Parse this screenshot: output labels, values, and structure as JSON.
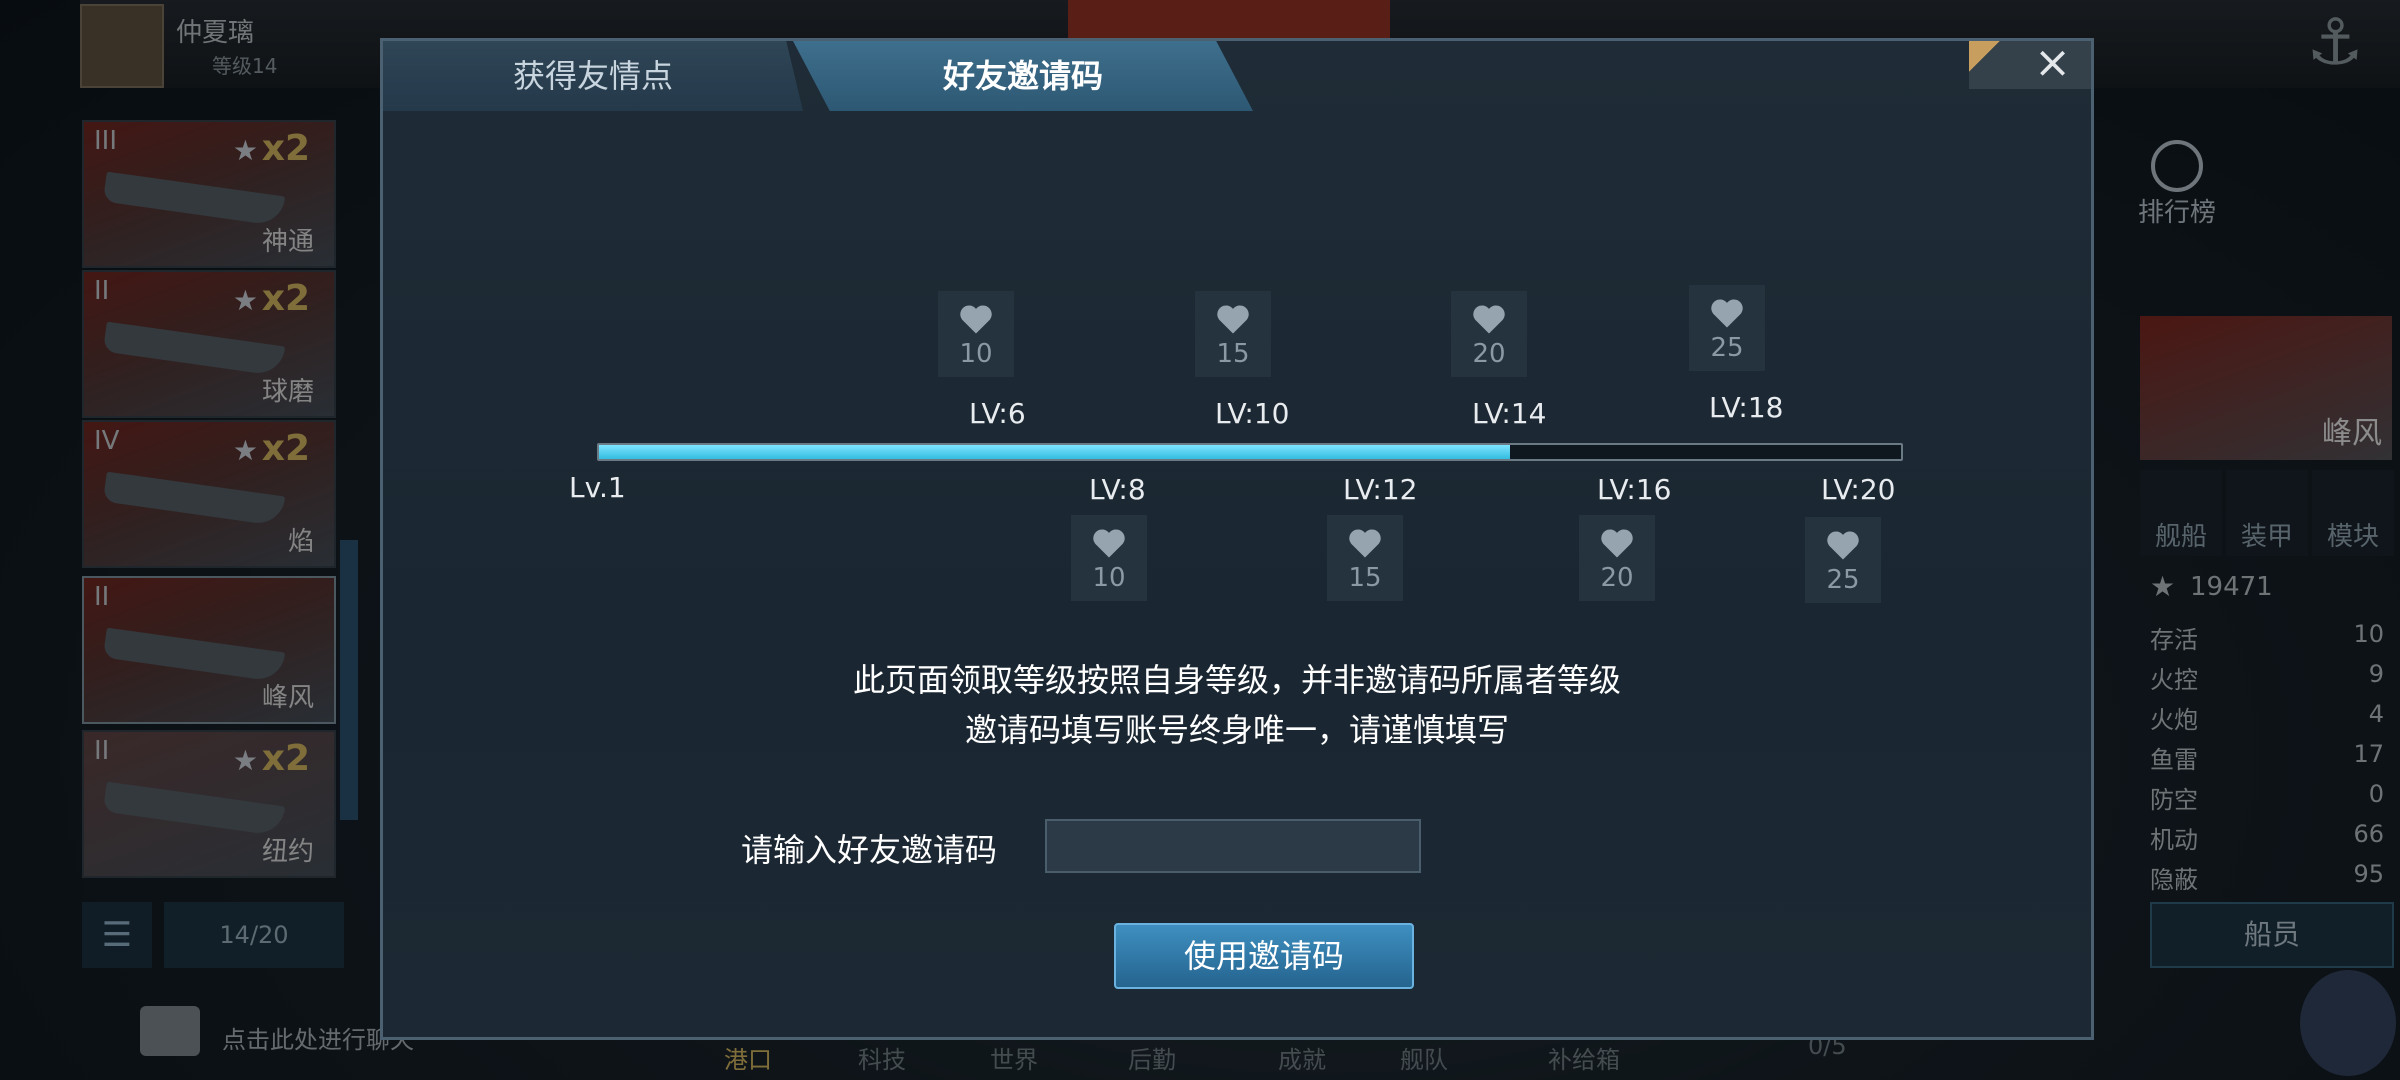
{
  "player": {
    "name": "仲夏璃",
    "level": "等级14"
  },
  "background": {
    "ships": [
      {
        "tier": "III",
        "name": "神通",
        "mult": "x2"
      },
      {
        "tier": "II",
        "name": "球磨",
        "mult": "x2"
      },
      {
        "tier": "IV",
        "name": "焰",
        "mult": "x2"
      },
      {
        "tier": "II",
        "name": "峰风",
        "mult": ""
      },
      {
        "tier": "II",
        "name": "纽约",
        "mult": "x2"
      }
    ],
    "fleet_count": "14/20",
    "chat_hint": "点击此处进行聊天",
    "ranking_label": "排行榜",
    "selected_ship": "峰风",
    "side_tabs": [
      "舰船",
      "装甲",
      "模块"
    ],
    "score": "19471",
    "stats": [
      {
        "label": "存活",
        "value": "10"
      },
      {
        "label": "火控",
        "value": "9"
      },
      {
        "label": "火炮",
        "value": "4"
      },
      {
        "label": "鱼雷",
        "value": "17"
      },
      {
        "label": "防空",
        "value": "0"
      },
      {
        "label": "机动",
        "value": "66"
      },
      {
        "label": "隐蔽",
        "value": "95"
      }
    ],
    "crew_button": "船员",
    "nav": [
      "港口",
      "科技",
      "世界",
      "后勤",
      "成就",
      "舰队",
      "补给箱"
    ],
    "queue": "0/5"
  },
  "modal": {
    "tabs": [
      "获得友情点",
      "好友邀请码"
    ],
    "close": "×",
    "start_level": "Lv.1",
    "progress": 0.7,
    "top_rewards": [
      {
        "level": "LV:6",
        "amount": "10"
      },
      {
        "level": "LV:10",
        "amount": "15"
      },
      {
        "level": "LV:14",
        "amount": "20"
      },
      {
        "level": "LV:18",
        "amount": "25"
      }
    ],
    "bottom_rewards": [
      {
        "level": "LV:8",
        "amount": "10"
      },
      {
        "level": "LV:12",
        "amount": "15"
      },
      {
        "level": "LV:16",
        "amount": "20"
      },
      {
        "level": "LV:20",
        "amount": "25"
      }
    ],
    "note_line1": "此页面领取等级按照自身等级，并非邀请码所属者等级",
    "note_line2": "邀请码填写账号终身唯一，请谨慎填写",
    "input_label": "请输入好友邀请码",
    "input_value": "",
    "use_button": "使用邀请码"
  }
}
